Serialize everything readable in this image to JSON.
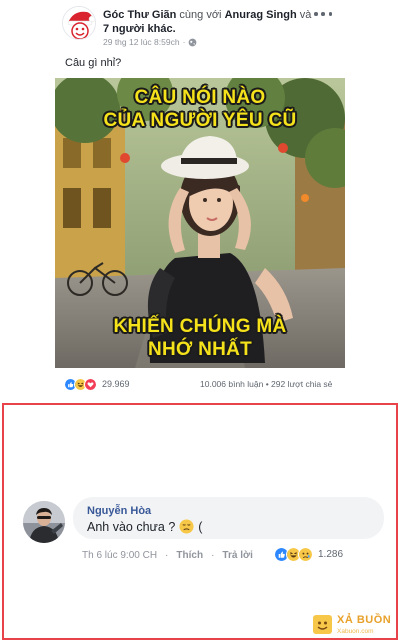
{
  "post": {
    "author": "Góc Thư Giãn",
    "with_text": "cùng với",
    "tagged_person": "Anurag Singh",
    "and_text": "và",
    "others": "7 người khác.",
    "timestamp": "29 thg 12 lúc 8:59ch",
    "caption": "Câu gì nhỉ?",
    "meme_top_line1": "CÂU NÓI NÀO",
    "meme_top_line2": "CỦA NGƯỜI YÊU CŨ",
    "meme_bottom_line1": "KHIẾN CHÚNG MÀ",
    "meme_bottom_line2": "NHỚ NHẤT"
  },
  "stats": {
    "reaction_count": "29.969",
    "comments_shares": "10.006 bình luận • 292 lượt chia sẻ",
    "reaction_types": [
      "like",
      "haha",
      "love"
    ]
  },
  "comment": {
    "author": "Nguyễn Hòa",
    "text": "Anh vào chưa ?",
    "text_suffix": "(",
    "time": "Th 6 lúc 9:00 CH",
    "like_label": "Thích",
    "reply_label": "Trả lời",
    "reaction_count": "1.286",
    "reaction_types": [
      "like",
      "haha",
      "sad"
    ]
  },
  "watermark": {
    "title": "XẢ BUỒN",
    "subtitle": "Xabuon.com"
  },
  "colors": {
    "highlight_border": "#e8434a",
    "link_blue": "#385898",
    "meme_yellow": "#f5e21a"
  }
}
